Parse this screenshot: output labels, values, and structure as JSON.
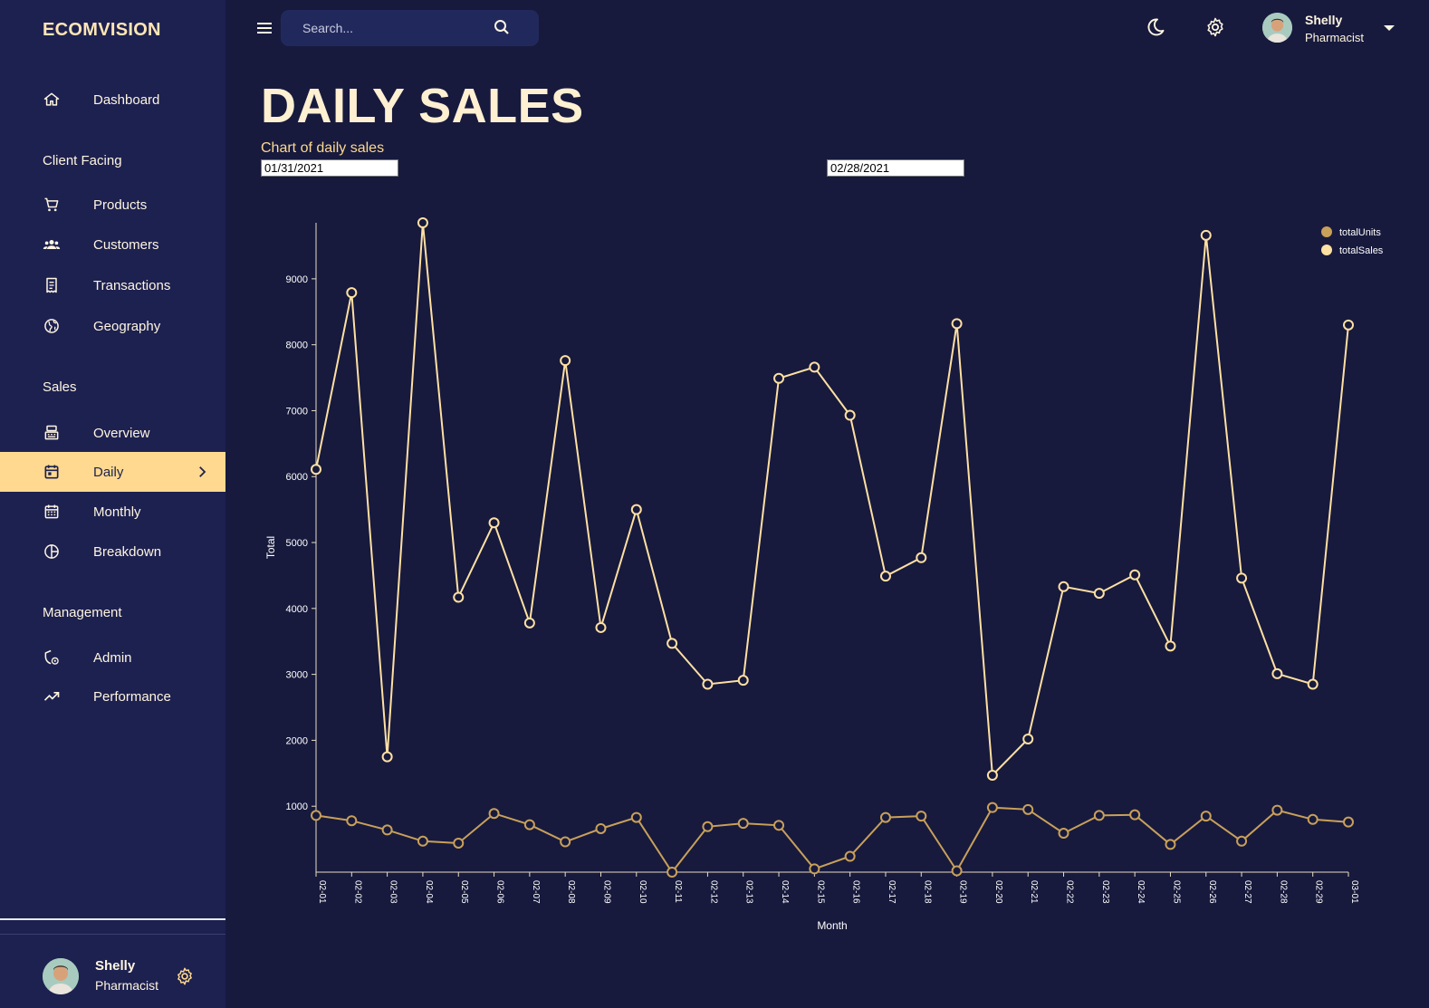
{
  "brand": "ECOMVISION",
  "sidebar": {
    "items": [
      {
        "label": "Dashboard"
      },
      {
        "label": "Products"
      },
      {
        "label": "Customers"
      },
      {
        "label": "Transactions"
      },
      {
        "label": "Geography"
      },
      {
        "label": "Overview"
      },
      {
        "label": "Daily"
      },
      {
        "label": "Monthly"
      },
      {
        "label": "Breakdown"
      },
      {
        "label": "Admin"
      },
      {
        "label": "Performance"
      }
    ],
    "sections": [
      "Client Facing",
      "Sales",
      "Management"
    ],
    "active": "Daily"
  },
  "user": {
    "name": "Shelly",
    "role": "Pharmacist"
  },
  "search": {
    "placeholder": "Search..."
  },
  "page": {
    "title": "DAILY SALES",
    "subtitle": "Chart of daily sales"
  },
  "dates": {
    "start": "01/31/2021",
    "end": "02/28/2021"
  },
  "colors": {
    "background": "#171a3d",
    "sidebar": "#1d2150",
    "accent": "#ffd98f",
    "totalSales": "#ffe0a3",
    "totalUnits": "#c9a05a"
  },
  "icons": [
    "menu-icon",
    "search-icon",
    "moon-icon",
    "gear-icon",
    "caret-down-icon",
    "home-icon",
    "cart-icon",
    "groups-icon",
    "receipt-icon",
    "globe-icon",
    "point-of-sale-icon",
    "calendar-today-icon",
    "calendar-month-icon",
    "pie-chart-icon",
    "admin-icon",
    "trending-up-icon"
  ],
  "chart_data": {
    "type": "line",
    "categories": [
      "02-01",
      "02-02",
      "02-03",
      "02-04",
      "02-05",
      "02-06",
      "02-07",
      "02-08",
      "02-09",
      "02-10",
      "02-11",
      "02-12",
      "02-13",
      "02-14",
      "02-15",
      "02-16",
      "02-17",
      "02-18",
      "02-19",
      "02-20",
      "02-21",
      "02-22",
      "02-23",
      "02-24",
      "02-25",
      "02-26",
      "02-27",
      "02-28",
      "02-29",
      "03-01"
    ],
    "series": [
      {
        "name": "totalUnits",
        "values": [
          860,
          780,
          640,
          470,
          440,
          890,
          720,
          460,
          660,
          830,
          0,
          690,
          740,
          710,
          50,
          240,
          830,
          850,
          20,
          980,
          950,
          590,
          860,
          870,
          420,
          850,
          470,
          940,
          800,
          760
        ]
      },
      {
        "name": "totalSales",
        "values": [
          6110,
          8790,
          1750,
          9850,
          4170,
          5300,
          3780,
          7760,
          3710,
          5500,
          3470,
          2850,
          2910,
          7490,
          7660,
          6930,
          4490,
          4770,
          8320,
          1470,
          2020,
          4330,
          4230,
          4510,
          3430,
          9660,
          4460,
          3010,
          2850,
          8300
        ]
      }
    ],
    "xlabel": "Month",
    "ylabel": "Total",
    "yticks": [
      1000,
      2000,
      3000,
      4000,
      5000,
      6000,
      7000,
      8000,
      9000
    ],
    "ylim": [
      0,
      9850
    ],
    "legend": "top-right",
    "grid": false
  }
}
